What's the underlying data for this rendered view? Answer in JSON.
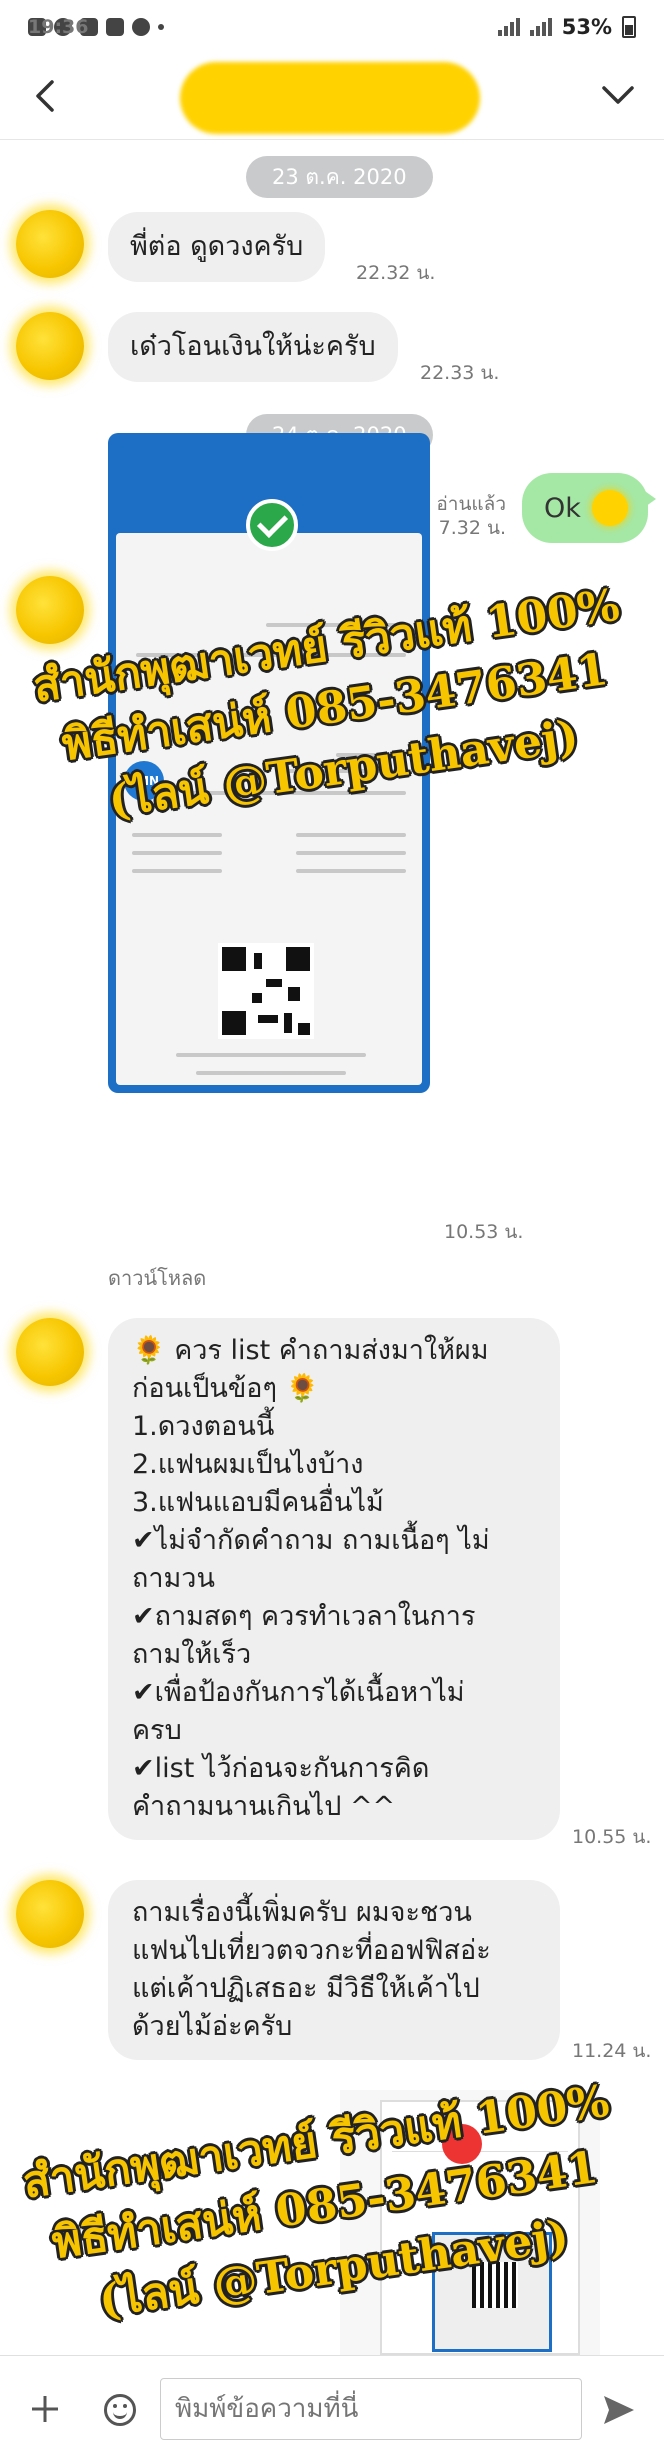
{
  "status_bar": {
    "time": "19:36",
    "battery": "53%"
  },
  "header": {
    "back_icon": "chevron-left-icon",
    "menu_icon": "chevron-down-icon"
  },
  "dates": [
    "23 ต.ค. 2020",
    "24 ต.ค. 2020"
  ],
  "messages": [
    {
      "text": "พี่ต่อ ดูดวงครับ",
      "time": "22.32 น."
    },
    {
      "text": "เด๋วโอนเงินให้น่ะครับ",
      "time": "22.33 น."
    },
    {
      "text": "Ok",
      "time": "7.32 น.",
      "read": "อ่านแล้ว"
    },
    {
      "time": "10.53 น.",
      "download": "ดาวน์โหลด"
    },
    {
      "lines": [
        "🌻 ควร list คำถามส่งมาให้ผม",
        "ก่อนเป็นข้อๆ 🌻",
        "1.ดวงตอนนี้",
        "2.แฟนผมเป็นไงบ้าง",
        "3.แฟนแอบมีคนอื่นไม้",
        "✔ไม่จำกัดคำถาม ถามเนื้อๆ ไม่",
        "ถามวน",
        "✔ถามสดๆ ควรทำเวลาในการ",
        "ถามให้เร็ว",
        "✔เพื่อป้องกันการได้เนื้อหาไม่",
        "ครบ",
        "✔list ไว้ก่อนจะกันการคิด",
        "คำถามนานเกินไป ^^"
      ],
      "time": "10.55 น."
    },
    {
      "lines": [
        "ถามเรื่องนี้เพิ่มครับ ผมจะชวน",
        "แฟนไปเที่ยวตจวกะที่ออฟฟิสอ่ะ",
        "แต่เค้าปฏิเสธอะ มีวิธีให้เค้าไป",
        "ด้วยไม้อ่ะครับ"
      ],
      "time": "11.24 น."
    }
  ],
  "watermark": {
    "line1": "สำนักพุฒาเวทย์ รีวิวแท้ 100%",
    "line2": "พิธีทำเสน่ห์ 085-3476341",
    "line3": "(ไลน์ @Torputhavej)"
  },
  "input": {
    "placeholder": "พิมพ์ข้อความที่นี่"
  },
  "colors": {
    "my_bubble": "#a5e8a5",
    "their_bubble": "#efefef",
    "watermark": "#f7c400",
    "avatar": "#f7c600"
  }
}
